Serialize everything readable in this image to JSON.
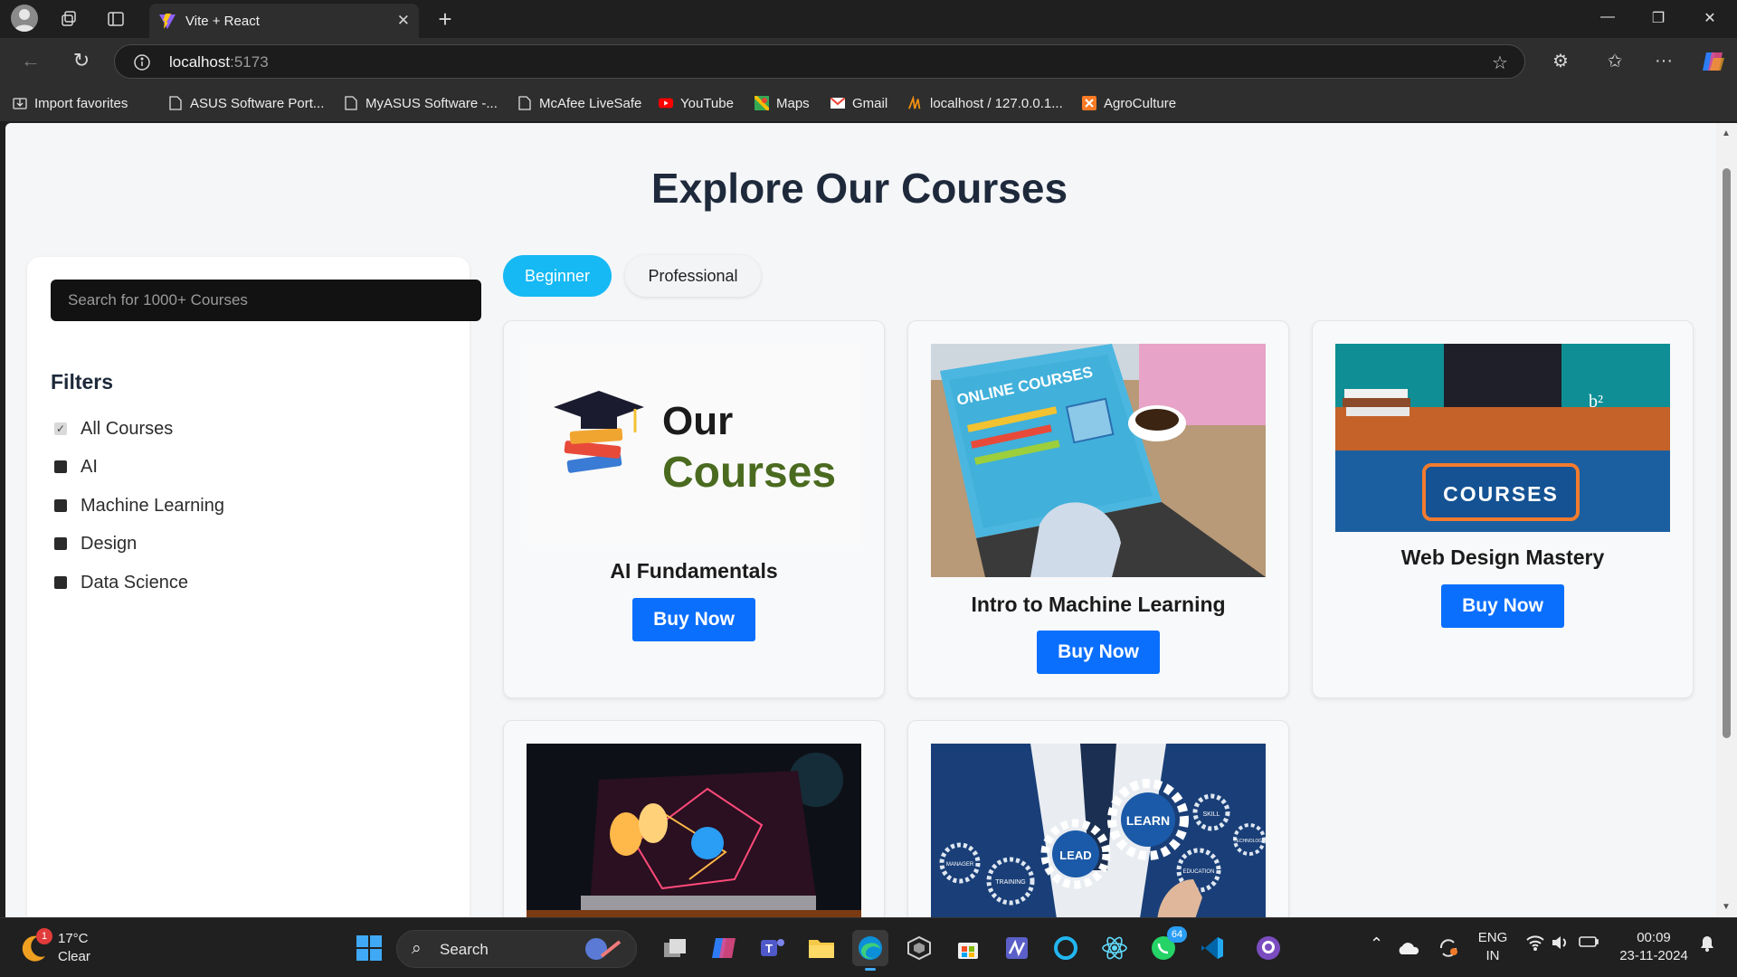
{
  "browser": {
    "tab_title": "Vite + React",
    "url_host": "localhost",
    "url_port": ":5173",
    "bookmarks": [
      {
        "label": "Import favorites",
        "icon": "import-icon"
      },
      {
        "label": "ASUS Software Port...",
        "icon": "page-icon"
      },
      {
        "label": "MyASUS Software -...",
        "icon": "page-icon"
      },
      {
        "label": "McAfee LiveSafe",
        "icon": "page-icon"
      },
      {
        "label": "YouTube",
        "icon": "youtube-icon"
      },
      {
        "label": "Maps",
        "icon": "maps-icon"
      },
      {
        "label": "Gmail",
        "icon": "gmail-icon"
      },
      {
        "label": "localhost / 127.0.0.1...",
        "icon": "phpmyadmin-icon"
      },
      {
        "label": "AgroCulture",
        "icon": "xampp-icon"
      }
    ]
  },
  "page": {
    "title": "Explore Our Courses",
    "search_placeholder": "Search for 1000+ Courses",
    "filters_title": "Filters",
    "filters": [
      {
        "label": "All Courses",
        "checked": true
      },
      {
        "label": "AI",
        "checked": false
      },
      {
        "label": "Machine Learning",
        "checked": false
      },
      {
        "label": "Design",
        "checked": false
      },
      {
        "label": "Data Science",
        "checked": false
      }
    ],
    "levels": [
      {
        "label": "Beginner",
        "active": true
      },
      {
        "label": "Professional",
        "active": false
      }
    ],
    "courses": [
      {
        "title": "AI Fundamentals",
        "button": "Buy Now",
        "image_text_1": "Our",
        "image_text_2": "Courses"
      },
      {
        "title": "Intro to Machine Learning",
        "button": "Buy Now",
        "image_text": "ONLINE COURSES"
      },
      {
        "title": "Web Design Mastery",
        "button": "Buy Now",
        "image_text": "COURSES"
      },
      {
        "title": "",
        "button": ""
      },
      {
        "title": "",
        "button": "",
        "image_words": [
          "LEARN",
          "LEAD",
          "SKILL",
          "TRAINING",
          "MANAGER",
          "EDUCATION",
          "TECHNOLOGY"
        ]
      }
    ],
    "accent_color": "#16b9f4",
    "button_color": "#0b6ffd"
  },
  "taskbar": {
    "weather_temp": "17°C",
    "weather_cond": "Clear",
    "weather_badge": "1",
    "search_label": "Search",
    "whatsapp_badge": "64",
    "lang_1": "ENG",
    "lang_2": "IN",
    "time": "00:09",
    "date": "23-11-2024"
  }
}
